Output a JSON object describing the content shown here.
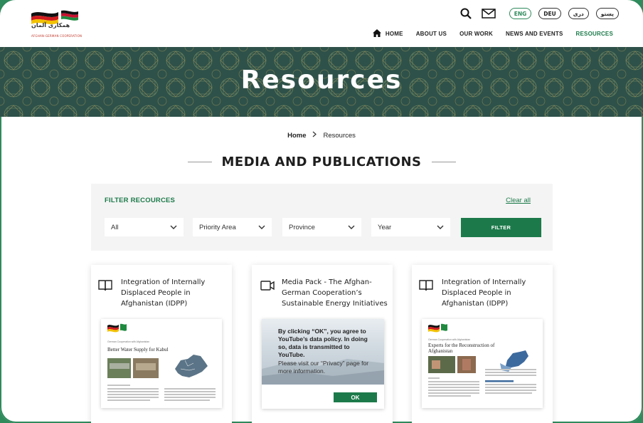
{
  "header": {
    "logo_text": "همکاری آلمان",
    "logo_tagline": "AFGHAN-GERMAN COOPERATION",
    "languages": [
      {
        "label": "ENG",
        "active": true
      },
      {
        "label": "DEU",
        "active": false
      },
      {
        "label": "دری",
        "active": false
      },
      {
        "label": "پښتو",
        "active": false
      }
    ],
    "nav": [
      {
        "label": "HOME",
        "active": false
      },
      {
        "label": "ABOUT US",
        "active": false
      },
      {
        "label": "OUR WORK",
        "active": false
      },
      {
        "label": "NEWS AND EVENTS",
        "active": false
      },
      {
        "label": "RESOURCES",
        "active": true
      }
    ]
  },
  "banner": {
    "title": "Resources"
  },
  "breadcrumb": {
    "home": "Home",
    "current": "Resources"
  },
  "section": {
    "title": "MEDIA AND PUBLICATIONS"
  },
  "filter": {
    "label": "FILTER RECOURCES",
    "clear_label": "Clear all",
    "selects": [
      "All",
      "Priority Area",
      "Province",
      "Year"
    ],
    "button_label": "FILTER"
  },
  "cards": [
    {
      "icon": "book-icon",
      "title": "Integration of Internally Displaced People in Afghanistan (IDPP)",
      "doc_subtitle": "German Cooperation with Afghanistan",
      "doc_title": "Better Water Supply for Kabul"
    },
    {
      "icon": "video-icon",
      "title": "Media Pack - The Afghan-German Cooperation’s Sustainable Energy Initiatives",
      "consent_text": "By clicking “OK”, you agree to YouTube’s data policy. In doing so, data is transmitted to YouTube.",
      "privacy_text": "Please visit our “Privacy” page for more information.",
      "ok_label": "OK"
    },
    {
      "icon": "book-icon",
      "title": "Integration of Internally Displaced People in Afghanistan (IDPP)",
      "doc_subtitle": "German Cooperation with Afghanistan",
      "doc_title": "Experts for the Reconstruction of Afghanistan"
    }
  ],
  "colors": {
    "brand_green": "#1c7a4a",
    "banner": "#2e5149",
    "frame": "#2f8a5c"
  }
}
